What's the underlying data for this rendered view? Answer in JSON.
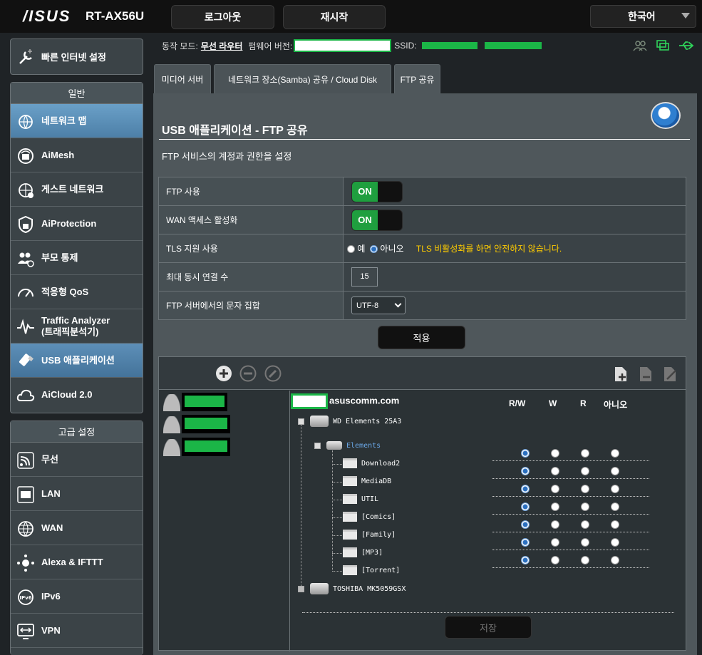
{
  "header": {
    "brand": "/ISUS",
    "model": "RT-AX56U",
    "logout_label": "로그아웃",
    "reboot_label": "재시작",
    "language": "한국어"
  },
  "status": {
    "mode_label": "동작 모드:",
    "mode_value": "무선 라우터",
    "firmware_label": "펌웨어 버전:",
    "ssid_label": "SSID:"
  },
  "sidebar": {
    "quick_setup": "빠른 인터넷 설정",
    "general_title": "일반",
    "general_items": [
      {
        "label": "네트워크 맵",
        "icon": "network-map-icon"
      },
      {
        "label": "AiMesh",
        "icon": "aimesh-icon"
      },
      {
        "label": "게스트 네트워크",
        "icon": "guest-network-icon"
      },
      {
        "label": "AiProtection",
        "icon": "shield-lock-icon"
      },
      {
        "label": "부모 통제",
        "icon": "parental-icon"
      },
      {
        "label": "적응형 QoS",
        "icon": "gauge-icon"
      },
      {
        "label": "Traffic Analyzer",
        "label2": "(트래픽분석기)",
        "icon": "analyzer-icon"
      },
      {
        "label": "USB 애플리케이션",
        "icon": "usb-icon"
      },
      {
        "label": "AiCloud 2.0",
        "icon": "cloud-icon"
      }
    ],
    "advanced_title": "고급 설정",
    "advanced_items": [
      {
        "label": "무선",
        "icon": "wireless-icon"
      },
      {
        "label": "LAN",
        "icon": "lan-icon"
      },
      {
        "label": "WAN",
        "icon": "globe-icon"
      },
      {
        "label": "Alexa & IFTTT",
        "icon": "alexa-icon"
      },
      {
        "label": "IPv6",
        "icon": "ipv6-icon"
      },
      {
        "label": "VPN",
        "icon": "vpn-icon"
      }
    ]
  },
  "tabs": [
    {
      "label": "미디어 서버"
    },
    {
      "label": "네트워크 장소(Samba) 공유 / Cloud Disk"
    },
    {
      "label": "FTP 공유"
    }
  ],
  "main": {
    "title": "USB 애플리케이션 - FTP 공유",
    "description": "FTP 서비스의 계정과 권한을 설정",
    "settings": [
      {
        "label": "FTP 사용",
        "toggle": "ON"
      },
      {
        "label": "WAN 액세스 활성화",
        "toggle": "ON"
      },
      {
        "label": "TLS 지원 사용",
        "opt_yes": "예",
        "opt_no": "아니오",
        "warning": "TLS 비활성화를 하면 안전하지 않습니다."
      },
      {
        "label": "최대 동시 연결 수",
        "value": "15"
      },
      {
        "label": "FTP 서버에서의 문자 집합",
        "value": "UTF-8"
      }
    ],
    "apply_label": "적용",
    "save_label": "저장"
  },
  "share": {
    "host_suffix": "asuscomm.com",
    "columns": [
      "R/W",
      "W",
      "R",
      "아니오"
    ],
    "drive1": "WD Elements 25A3",
    "partition": "Elements",
    "folders": [
      "Download2",
      "MediaDB",
      "UTIL",
      "[Comics]",
      "[Family]",
      "[MP3]",
      "[Torrent]"
    ],
    "drive2": "TOSHIBA MK5059GSX",
    "selected_permission": "R/W"
  },
  "colors": {
    "accent_blue": "#4d7fa7",
    "on_green": "#1f9f3f",
    "warning": "#ffcc00",
    "redaction": "#1bb647"
  }
}
